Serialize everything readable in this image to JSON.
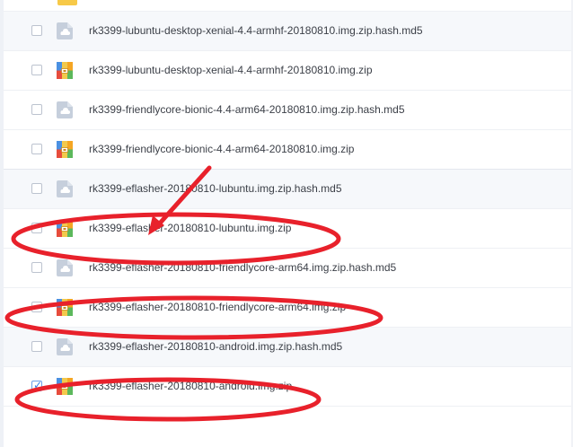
{
  "files": [
    {
      "name": "rk3399-lubuntu-desktop-xenial-4.4-armhf-20180810.img.zip.hash.md5",
      "icon": "cloud-file-icon",
      "checked": false
    },
    {
      "name": "rk3399-lubuntu-desktop-xenial-4.4-armhf-20180810.img.zip",
      "icon": "archive-icon",
      "checked": false
    },
    {
      "name": "rk3399-friendlycore-bionic-4.4-arm64-20180810.img.zip.hash.md5",
      "icon": "cloud-file-icon",
      "checked": false
    },
    {
      "name": "rk3399-friendlycore-bionic-4.4-arm64-20180810.img.zip",
      "icon": "archive-icon",
      "checked": false
    },
    {
      "name": "rk3399-eflasher-20180810-lubuntu.img.zip.hash.md5",
      "icon": "cloud-file-icon",
      "checked": false
    },
    {
      "name": "rk3399-eflasher-20180810-lubuntu.img.zip",
      "icon": "archive-icon",
      "checked": false
    },
    {
      "name": "rk3399-eflasher-20180810-friendlycore-arm64.img.zip.hash.md5",
      "icon": "cloud-file-icon",
      "checked": false
    },
    {
      "name": "rk3399-eflasher-20180810-friendlycore-arm64.img.zip",
      "icon": "archive-icon",
      "checked": false
    },
    {
      "name": "rk3399-eflasher-20180810-android.img.zip.hash.md5",
      "icon": "cloud-file-icon",
      "checked": false
    },
    {
      "name": "rk3399-eflasher-20180810-android.img.zip",
      "icon": "archive-icon",
      "checked": true
    }
  ],
  "colors": {
    "annotation_red": "#e8212b",
    "checkbox_blue": "#2f7be6"
  }
}
